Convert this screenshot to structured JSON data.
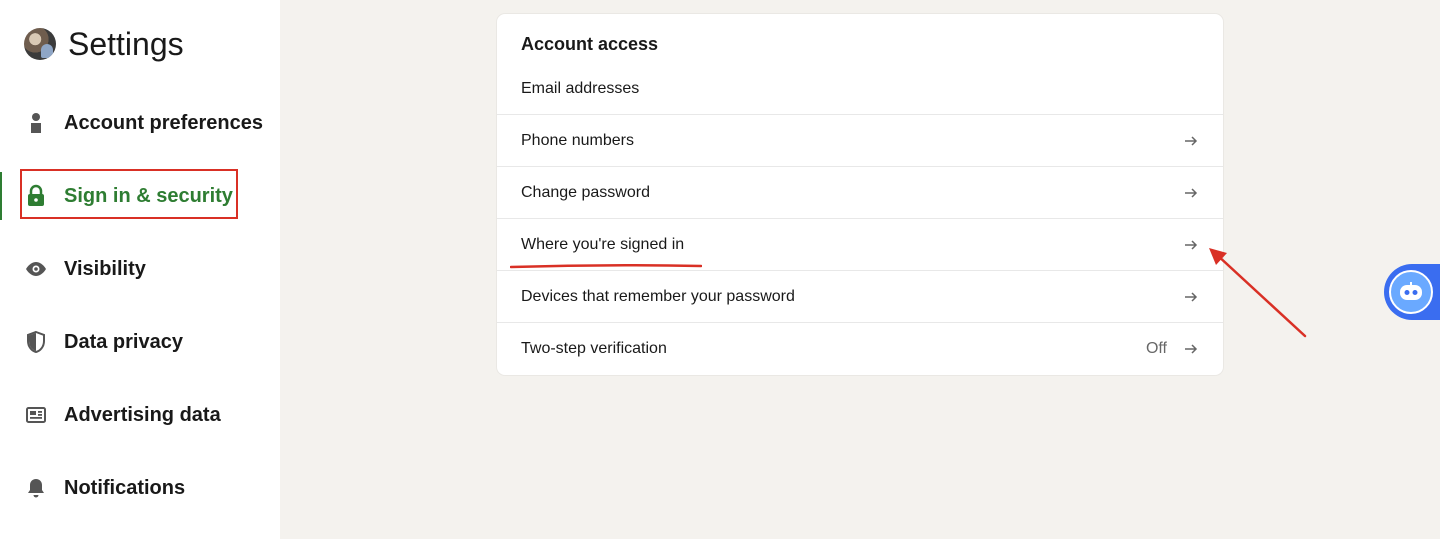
{
  "sidebar": {
    "title": "Settings",
    "items": [
      {
        "label": "Account preferences",
        "icon": "person-icon"
      },
      {
        "label": "Sign in & security",
        "icon": "lock-icon",
        "active": true
      },
      {
        "label": "Visibility",
        "icon": "eye-icon"
      },
      {
        "label": "Data privacy",
        "icon": "shield-icon"
      },
      {
        "label": "Advertising data",
        "icon": "newspaper-icon"
      },
      {
        "label": "Notifications",
        "icon": "bell-icon"
      }
    ]
  },
  "card": {
    "title": "Account access",
    "rows": [
      {
        "label": "Email addresses"
      },
      {
        "label": "Phone numbers"
      },
      {
        "label": "Change password"
      },
      {
        "label": "Where you're signed in"
      },
      {
        "label": "Devices that remember your password"
      },
      {
        "label": "Two-step verification",
        "status": "Off"
      }
    ]
  },
  "colors": {
    "accent": "#2e7d32",
    "annotation": "#d93025",
    "background": "#f4f2ee",
    "assistant": "#3a6df0"
  }
}
